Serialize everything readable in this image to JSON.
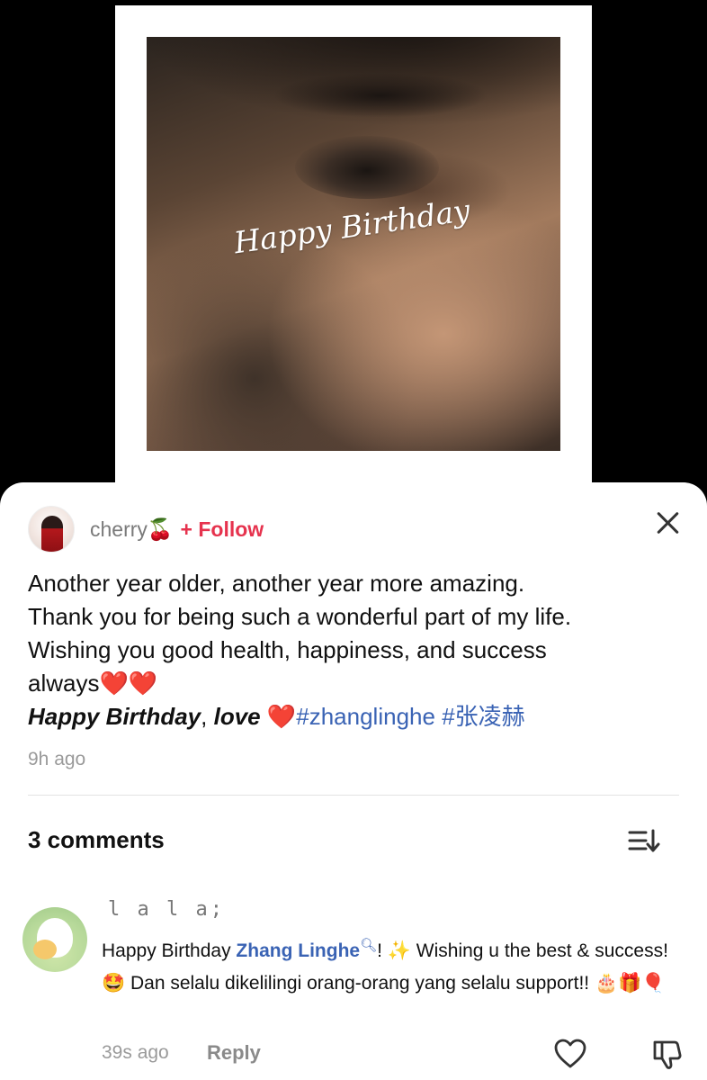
{
  "photo": {
    "overlay_text": "Happy Birthday"
  },
  "post": {
    "author": "cherry🍒",
    "follow_label": "+ Follow",
    "lines": [
      "Another year older, another year more amazing.",
      "Thank you for being such a wonderful part of my life.",
      "Wishing you good health, happiness, and success",
      "always"
    ],
    "hearts": "❤️❤️",
    "closing_bold": "Happy Birthday",
    "closing_sep": ", ",
    "closing_love": "love",
    "closing_heart": "❤️",
    "hashtags": [
      "#zhanglinghe",
      "#张凌赫"
    ],
    "time": "9h ago"
  },
  "comments_header": {
    "count_label": "3 comments"
  },
  "comment": {
    "author": "l a l a;",
    "text_prefix": "Happy Birthday ",
    "mention": "Zhang Linghe",
    "text_after_mention": "! ✨ Wishing u the best & success! 🤩 Dan selalu dikelilingi orang-orang yang selalu support!! 🎂🎁🎈",
    "time": "39s ago",
    "reply_label": "Reply"
  },
  "colors": {
    "accent": "#e6334e",
    "hashtag": "#3a63b4",
    "muted": "#9a9a9a"
  },
  "icons": {
    "close": "close-icon",
    "sort": "sort-icon",
    "like": "heart-outline-icon",
    "dislike": "thumbs-down-icon",
    "mention_search": "search-icon"
  }
}
